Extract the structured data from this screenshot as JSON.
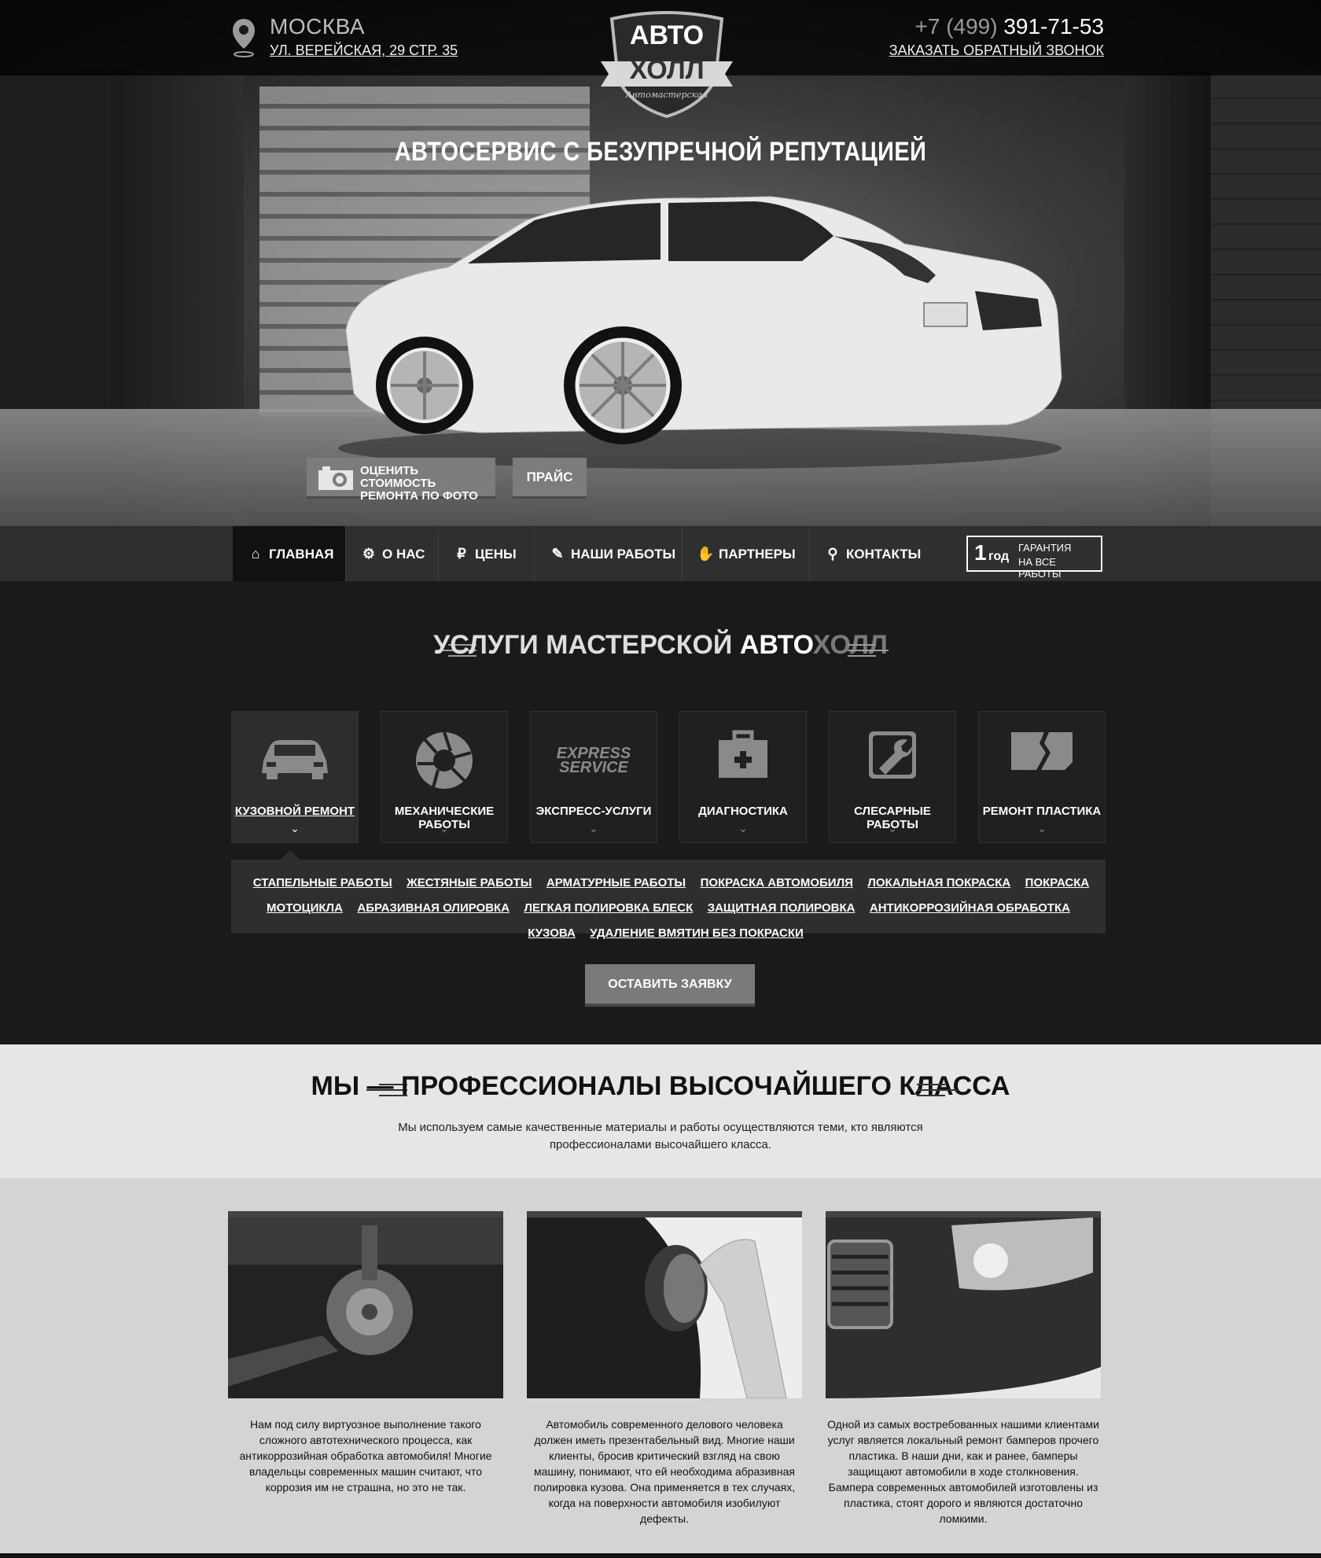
{
  "header": {
    "city": "МОСКВА",
    "address": "УЛ. ВЕРЕЙСКАЯ, 29 СТР. 35",
    "phone_prefix": "+7 (499)",
    "phone_number": "391-71-53",
    "callback_link": "ЗАКАЗАТЬ ОБРАТНЫЙ ЗВОНОК",
    "logo_line1": "АВТО",
    "logo_line2": "ХОЛЛ",
    "logo_tagline": "Автомастерская"
  },
  "hero": {
    "title": "АВТОСЕРВИС С БЕЗУПРЕЧНОЙ РЕПУТАЦИЕЙ",
    "photo_button_line1": "ОЦЕНИТЬ СТОИМОСТЬ",
    "photo_button_line2": "РЕМОНТА ПО ФОТО",
    "price_button": "ПРАЙС"
  },
  "nav": {
    "items": [
      {
        "label": "ГЛАВНАЯ",
        "icon": "home-icon",
        "active": true
      },
      {
        "label": "О НАС",
        "icon": "gear-wheel-icon"
      },
      {
        "label": "ЦЕНЫ",
        "icon": "ruble-icon"
      },
      {
        "label": "НАШИ РАБОТЫ",
        "icon": "spray-gun-icon"
      },
      {
        "label": "ПАРТНЕРЫ",
        "icon": "handshake-icon"
      },
      {
        "label": "КОНТАКТЫ",
        "icon": "map-pin-icon"
      }
    ],
    "warranty_number": "1",
    "warranty_unit": "год",
    "warranty_line1": "ГАРАНТИЯ",
    "warranty_line2": "НА ВСЕ РАБОТЫ"
  },
  "services": {
    "title_part1": "УСЛУГИ МАСТЕРСКОЙ",
    "title_part2": "АВТО",
    "title_part3": "ХОЛЛ",
    "cards": [
      {
        "label": "КУЗОВНОЙ РЕМОНТ",
        "icon": "car-icon",
        "active": true
      },
      {
        "label": "МЕХАНИЧЕСКИЕ РАБОТЫ",
        "icon": "aperture-icon"
      },
      {
        "label": "ЭКСПРЕСС-УСЛУГИ",
        "icon": "express-service-icon"
      },
      {
        "label": "ДИАГНОСТИКА",
        "icon": "first-aid-kit-icon"
      },
      {
        "label": "СЛЕСАРНЫЕ РАБОТЫ",
        "icon": "wrench-icon"
      },
      {
        "label": "РЕМОНТ ПЛАСТИКА",
        "icon": "broken-plastic-icon"
      }
    ],
    "express_icon_text1": "EXPRESS",
    "express_icon_text2": "SERVICE",
    "sublinks": [
      "СТАПЕЛЬНЫЕ РАБОТЫ",
      "ЖЕСТЯНЫЕ РАБОТЫ",
      "АРМАТУРНЫЕ РАБОТЫ",
      "ПОКРАСКА АВТОМОБИЛЯ",
      "ЛОКАЛЬНАЯ ПОКРАСКА",
      "ПОКРАСКА МОТОЦИКЛА",
      "АБРАЗИВНАЯ ОЛИРОВКА",
      "ЛЕГКАЯ ПОЛИРОВКА БЛЕСК",
      "ЗАЩИТНАЯ ПОЛИРОВКА",
      "АНТИКОРРОЗИЙНАЯ ОБРАБОТКА КУЗОВА",
      "УДАЛЕНИЕ ВМЯТИН БЕЗ ПОКРАСКИ"
    ],
    "request_button": "ОСТАВИТЬ ЗАЯВКУ"
  },
  "pro": {
    "title": "МЫ — ПРОФЕССИОНАЛЫ ВЫСОЧАЙШЕГО КЛАССА",
    "subtitle": "Мы используем самые качественные материалы и работы осуществляются теми, кто являются профессионалами высочайшего класса."
  },
  "gallery": [
    {
      "caption": "Нам под силу виртуозное выполнение такого сложного автотехнического процесса, как антикоррозийная обработка автомобиля! Многие владельцы современных машин считают, что коррозия им не страшна, но это не так."
    },
    {
      "caption": "Автомобиль современного делового человека должен иметь презентабельный вид. Многие наши клиенты, бросив критический взгляд на свою машину, понимают, что ей необходима абразивная полировка кузова. Она применяется в тех случаях, когда на поверхности автомобиля изобилуют дефекты."
    },
    {
      "caption": "Одной из самых востребованных нашими клиентами услуг является локальный ремонт бамперов прочего пластика. В наши дни, как и ранее, бамперы защищают автомобили в ходе столкновения. Бампера современных автомобилей изготовлены из пластика, стоят дорого и являются достаточно ломкими."
    }
  ]
}
